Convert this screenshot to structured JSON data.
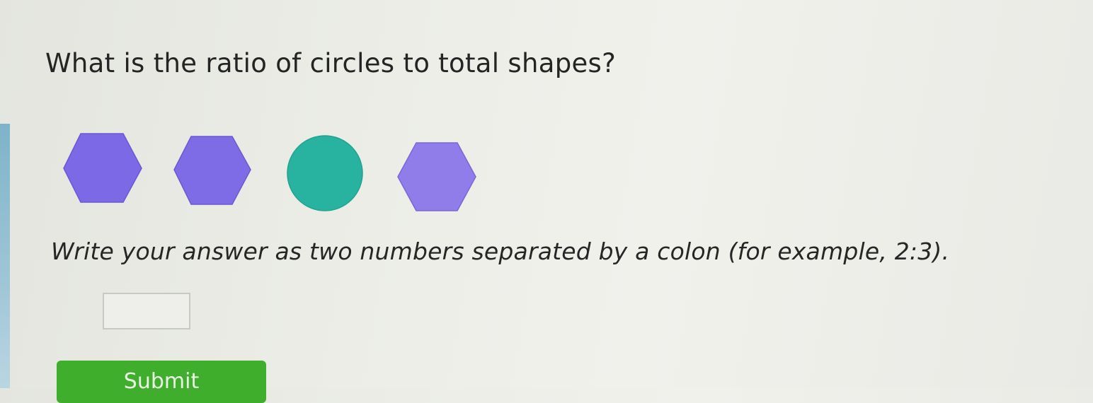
{
  "question": {
    "text": "What is the ratio of circles to total shapes?"
  },
  "shapes": [
    {
      "kind": "hexagon",
      "color": "#7b69e6",
      "icon": "hexagon-icon"
    },
    {
      "kind": "hexagon",
      "color": "#7d6ce6",
      "icon": "hexagon-icon"
    },
    {
      "kind": "circle",
      "color": "#28b3a1",
      "icon": "circle-icon"
    },
    {
      "kind": "hexagon",
      "color": "#917de9",
      "icon": "hexagon-icon"
    }
  ],
  "instruction": {
    "text": "Write your answer as two numbers separated by a colon (for example, 2:3)."
  },
  "answer": {
    "value": "",
    "placeholder": ""
  },
  "submit": {
    "label": "Submit",
    "color": "#3fae2d"
  }
}
